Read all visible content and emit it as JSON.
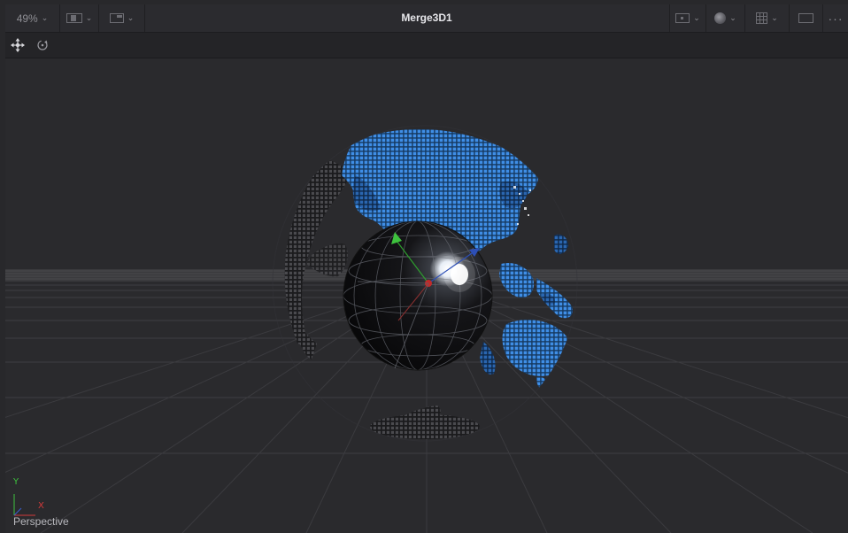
{
  "toolbar": {
    "zoom_level": "49%",
    "title": "Merge3D1",
    "left_icons": [
      "layout-single-icon",
      "layout-split-icon"
    ],
    "right_icons": [
      "monitor-icon",
      "color-channel-icon",
      "grid-icon",
      "roi-rect-icon",
      "more-options-icon"
    ]
  },
  "tools": [
    "transform-move-icon",
    "rotate-icon"
  ],
  "viewport": {
    "view_name": "Perspective",
    "axis_y": "Y",
    "axis_x": "X"
  },
  "colors": {
    "background": "#2a2a2d",
    "globe_blue": "#2a6fc2",
    "sphere": "#0a0a0c",
    "axis_y": "#3ec23e",
    "axis_x": "#d33a3a"
  }
}
